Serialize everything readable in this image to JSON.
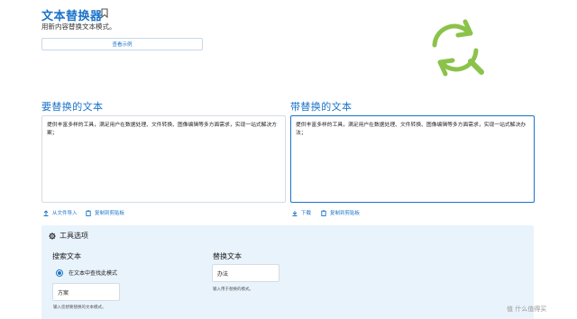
{
  "header": {
    "title": "文本替换器",
    "subtitle": "用新内容替换文本模式。",
    "example_button": "查看示例"
  },
  "left_panel": {
    "title": "要替换的文本",
    "content": "提供丰富多样的工具，满足用户在数据处理、文件转换、图像编辑等多方面需求，实现一站式解决方案；",
    "actions": {
      "import": "从文件导入",
      "copy": "复制到剪贴板"
    }
  },
  "right_panel": {
    "title": "带替换的文本",
    "content": "提供丰富多样的工具，满足用户在数据处理、文件转换、图像编辑等多方面需求，实现一站式解决办法；",
    "actions": {
      "download": "下载",
      "copy": "复制到剪贴板"
    }
  },
  "options": {
    "header": "工具选项",
    "search": {
      "label": "搜索文本",
      "radio_label": "在文本中查找此模式",
      "value": "方案",
      "hint": "输入您想要替换的文本模式。"
    },
    "replace": {
      "label": "替换文本",
      "value": "办法",
      "hint": "输入用于替换的模式。"
    }
  },
  "watermark": "值 什么值得买",
  "colors": {
    "accent": "#1a73c8",
    "logo": "#8bc34a",
    "options_bg": "#e9f3fc"
  },
  "icons": [
    "bookmark-icon",
    "replace-search-icon",
    "import-icon",
    "copy-icon",
    "download-icon",
    "gear-icon"
  ]
}
